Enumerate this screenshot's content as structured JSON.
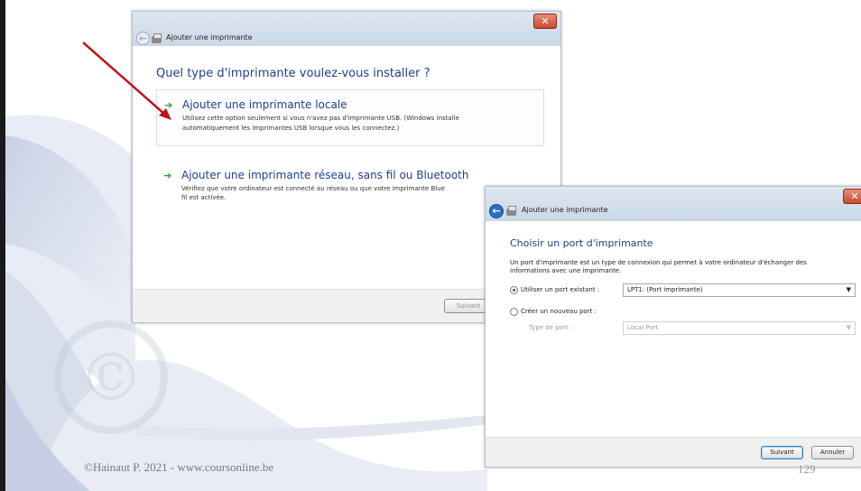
{
  "footer": {
    "copyright": "©Hainaut P. 2021 - www.coursonline.be",
    "page_number": "129"
  },
  "window1": {
    "title": "Ajouter une imprimante",
    "heading": "Quel type d'imprimante voulez-vous installer ?",
    "option_local": {
      "title": "Ajouter une imprimante locale",
      "description_line1": "Utilisez cette option seulement si vous n'avez pas d'imprimante USB. (Windows installe",
      "description_line2": "automatiquement les imprimantes USB lorsque vous les connectez.)"
    },
    "option_network": {
      "title": "Ajouter une imprimante réseau, sans fil ou Bluetooth",
      "description_line1": "Vérifiez que votre ordinateur est connecté au réseau ou que votre imprimante Blue",
      "description_line2": "fil est activée."
    },
    "next_button": "Suivant"
  },
  "window2": {
    "title": "Ajouter une imprimante",
    "heading": "Choisir un port d'imprimante",
    "description_line1": "Un port d'imprimante est un type de connexion qui permet à votre ordinateur d'échanger des",
    "description_line2": "informations avec une imprimante.",
    "existing_port": {
      "label": "Utiliser un port existant :",
      "selected": true,
      "value": "LPT1: (Port imprimante)"
    },
    "new_port": {
      "label": "Créer un nouveau port :",
      "selected": false,
      "type_label": "Type de port :",
      "type_value": "Local Port"
    },
    "next_button": "Suivant",
    "cancel_button": "Annuler"
  },
  "colors": {
    "heading_blue": "#1e3f8c",
    "arrow_red": "#c0141b",
    "arrow_green": "#2aa32a"
  }
}
